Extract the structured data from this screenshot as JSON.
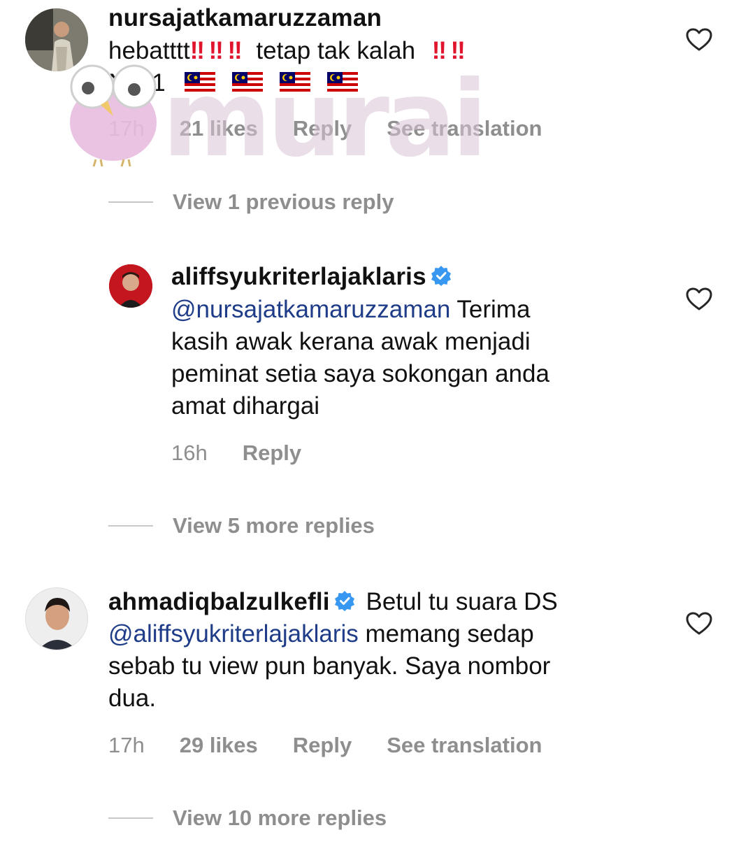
{
  "comments": [
    {
      "username": "nursajatkamaruzzaman",
      "text_part1": "hebatttt",
      "bangs1": [
        "‼",
        "‼",
        "‼"
      ],
      "text_part2": "tetap tak kalah",
      "bangs2": [
        "‼",
        "‼"
      ],
      "text_line2": "NO 1",
      "flags": [
        "malaysia-flag",
        "malaysia-flag",
        "malaysia-flag",
        "malaysia-flag"
      ],
      "time": "17h",
      "likes": "21 likes",
      "reply_label": "Reply",
      "translate_label": "See translation"
    },
    {
      "username": "aliffsyukriterlajaklaris",
      "verified": true,
      "mention": "@nursajatkamaruzzaman",
      "text_line1": "Terima",
      "text_line2": "kasih awak kerana awak menjadi",
      "text_line3": "peminat setia saya sokongan anda",
      "text_line4": "amat dihargai",
      "time": "16h",
      "reply_label": "Reply"
    },
    {
      "username": "ahmadiqbalzulkefli",
      "verified": true,
      "text_line1": "Betul tu suara DS",
      "mention": "@aliffsyukriterlajaklaris",
      "text_line2": "memang sedap",
      "text_line3": "sebab tu view pun banyak. Saya nombor",
      "text_line4": "dua.",
      "time": "17h",
      "likes": "29 likes",
      "reply_label": "Reply",
      "translate_label": "See translation"
    }
  ],
  "view_replies": {
    "first": "View 1 previous reply",
    "second": "View 5 more replies",
    "third": "View 10 more replies"
  },
  "watermark": {
    "text": "murai",
    "mascot": "bird-mascot"
  },
  "colors": {
    "mention": "#1f3c88",
    "muted": "#8e8e8e",
    "verified": "#3897f0",
    "bang": "#e0142c",
    "watermark": "#d9c6d6"
  },
  "icons": {
    "like": "heart-outline-icon",
    "verified": "verified-badge-icon"
  }
}
